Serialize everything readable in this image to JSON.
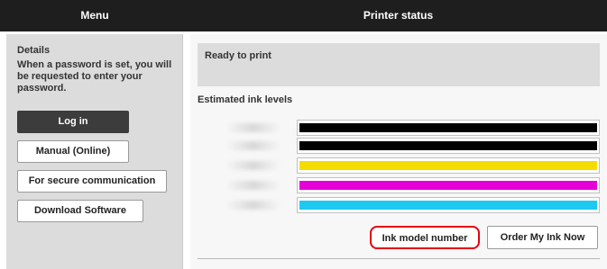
{
  "header": {
    "menu_title": "Menu",
    "status_title": "Printer status"
  },
  "sidebar": {
    "details_heading": "Details",
    "details_text": "When a password is set, you will be requested to enter your password.",
    "buttons": [
      {
        "label": "Log in"
      },
      {
        "label": "Manual (Online)"
      },
      {
        "label": "For secure communication"
      },
      {
        "label": "Download Software"
      }
    ]
  },
  "main": {
    "status_text": "Ready to print",
    "ink_heading": "Estimated ink levels",
    "ink_levels": [
      {
        "color_name": "black",
        "color": "#000000",
        "level": 1.0
      },
      {
        "color_name": "black",
        "color": "#000000",
        "level": 1.0
      },
      {
        "color_name": "yellow",
        "color": "#f5dc00",
        "level": 1.0
      },
      {
        "color_name": "magenta",
        "color": "#e600d8",
        "level": 1.0
      },
      {
        "color_name": "cyan",
        "color": "#1ec8f0",
        "level": 1.0
      }
    ],
    "ink_model_button": "Ink model number",
    "order_button": "Order My Ink Now"
  },
  "colors": {
    "header_bg": "#1e1e1e",
    "highlight": "#e60012",
    "panel_bg": "#dcdcdc"
  }
}
